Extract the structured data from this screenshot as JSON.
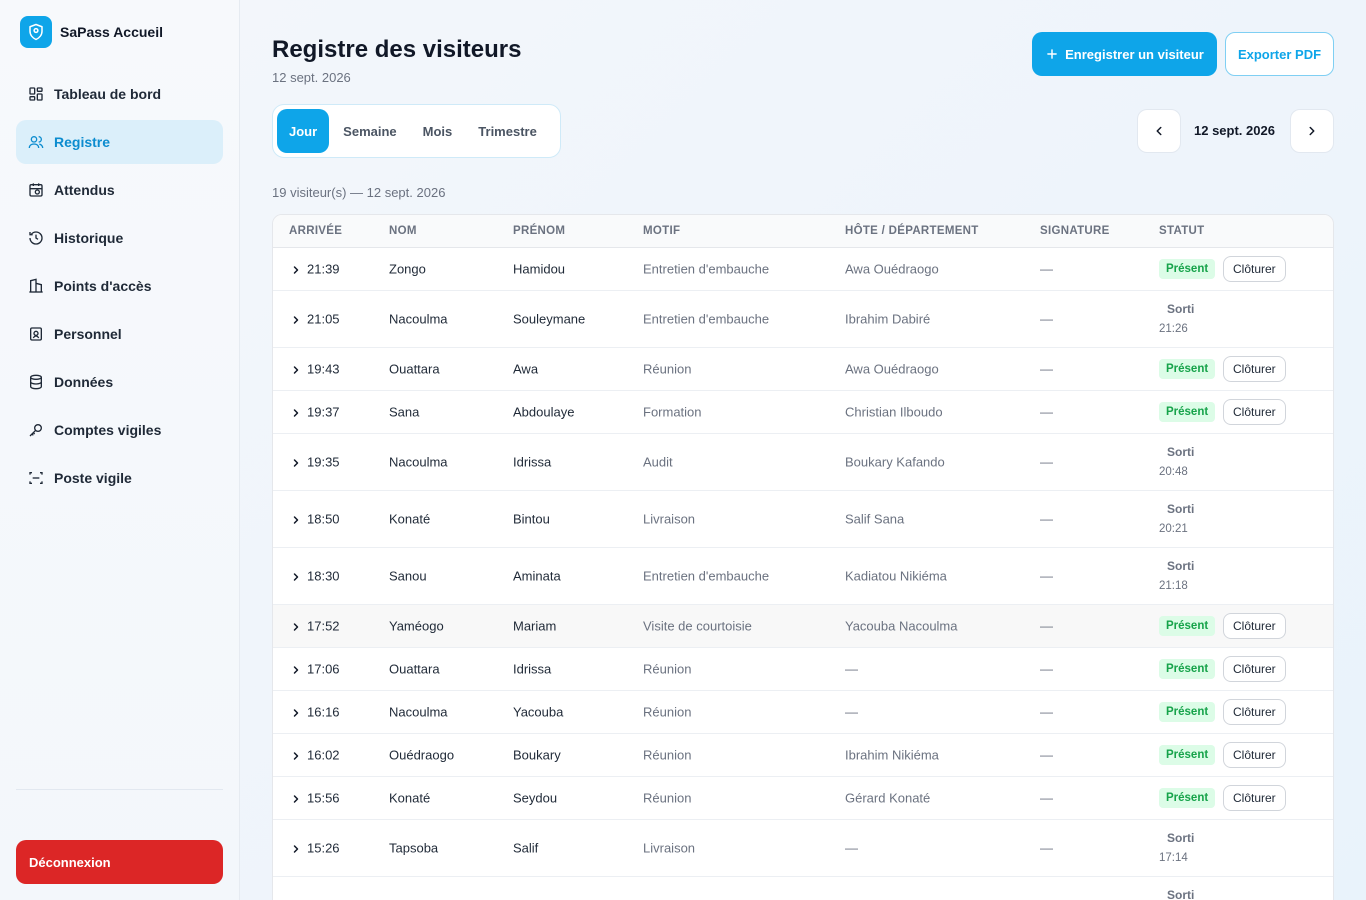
{
  "brand": {
    "name": "SaPass Accueil"
  },
  "sidebar": {
    "items": [
      {
        "label": "Tableau de bord",
        "icon": "dashboard-icon"
      },
      {
        "label": "Registre",
        "icon": "users-icon",
        "active": true
      },
      {
        "label": "Attendus",
        "icon": "calendar-clock-icon"
      },
      {
        "label": "Historique",
        "icon": "history-icon"
      },
      {
        "label": "Points d'accès",
        "icon": "building-icon"
      },
      {
        "label": "Personnel",
        "icon": "id-badge-icon"
      },
      {
        "label": "Données",
        "icon": "database-icon"
      },
      {
        "label": "Comptes vigiles",
        "icon": "key-icon"
      },
      {
        "label": "Poste vigile",
        "icon": "scan-icon"
      }
    ],
    "logout_label": "Déconnexion"
  },
  "header": {
    "title": "Registre des visiteurs",
    "date": "12 sept. 2026",
    "register_button": "Enregistrer un visiteur",
    "export_button": "Exporter PDF"
  },
  "period_tabs": [
    "Jour",
    "Semaine",
    "Mois",
    "Trimestre"
  ],
  "date_nav": {
    "label": "12 sept. 2026"
  },
  "count_label": "19 visiteur(s) — 12 sept. 2026",
  "table": {
    "columns": [
      "ARRIVÉE",
      "NOM",
      "PRÉNOM",
      "MOTIF",
      "HÔTE / DÉPARTEMENT",
      "SIGNATURE",
      "STATUT"
    ],
    "status_present": "Présent",
    "close_label": "Clôturer",
    "exited_label": "Sorti",
    "rows": [
      {
        "arrival": "21:39",
        "nom": "Zongo",
        "prenom": "Hamidou",
        "motif": "Entretien d'embauche",
        "hote": "Awa Ouédraogo",
        "signature": "—",
        "status": "present"
      },
      {
        "arrival": "21:05",
        "nom": "Nacoulma",
        "prenom": "Souleymane",
        "motif": "Entretien d'embauche",
        "hote": "Ibrahim Dabiré",
        "signature": "—",
        "status": "sorti",
        "exit_time": "21:26"
      },
      {
        "arrival": "19:43",
        "nom": "Ouattara",
        "prenom": "Awa",
        "motif": "Réunion",
        "hote": "Awa Ouédraogo",
        "signature": "—",
        "status": "present"
      },
      {
        "arrival": "19:37",
        "nom": "Sana",
        "prenom": "Abdoulaye",
        "motif": "Formation",
        "hote": "Christian Ilboudo",
        "signature": "—",
        "status": "present"
      },
      {
        "arrival": "19:35",
        "nom": "Nacoulma",
        "prenom": "Idrissa",
        "motif": "Audit",
        "hote": "Boukary Kafando",
        "signature": "—",
        "status": "sorti",
        "exit_time": "20:48"
      },
      {
        "arrival": "18:50",
        "nom": "Konaté",
        "prenom": "Bintou",
        "motif": "Livraison",
        "hote": "Salif Sana",
        "signature": "—",
        "status": "sorti",
        "exit_time": "20:21"
      },
      {
        "arrival": "18:30",
        "nom": "Sanou",
        "prenom": "Aminata",
        "motif": "Entretien d'embauche",
        "hote": "Kadiatou Nikiéma",
        "signature": "—",
        "status": "sorti",
        "exit_time": "21:18"
      },
      {
        "arrival": "17:52",
        "nom": "Yaméogo",
        "prenom": "Mariam",
        "motif": "Visite de courtoisie",
        "hote": "Yacouba Nacoulma",
        "signature": "—",
        "status": "present",
        "highlight": true
      },
      {
        "arrival": "17:06",
        "nom": "Ouattara",
        "prenom": "Idrissa",
        "motif": "Réunion",
        "hote": "—",
        "signature": "—",
        "status": "present"
      },
      {
        "arrival": "16:16",
        "nom": "Nacoulma",
        "prenom": "Yacouba",
        "motif": "Réunion",
        "hote": "—",
        "signature": "—",
        "status": "present"
      },
      {
        "arrival": "16:02",
        "nom": "Ouédraogo",
        "prenom": "Boukary",
        "motif": "Réunion",
        "hote": "Ibrahim Nikiéma",
        "signature": "—",
        "status": "present"
      },
      {
        "arrival": "15:56",
        "nom": "Konaté",
        "prenom": "Seydou",
        "motif": "Réunion",
        "hote": "Gérard Konaté",
        "signature": "—",
        "status": "present"
      },
      {
        "arrival": "15:26",
        "nom": "Tapsoba",
        "prenom": "Salif",
        "motif": "Livraison",
        "hote": "—",
        "signature": "—",
        "status": "sorti",
        "exit_time": "17:14"
      },
      {
        "arrival": "",
        "nom": "",
        "prenom": "",
        "motif": "",
        "hote": "",
        "signature": "",
        "status": "sorti",
        "exit_time": ""
      }
    ]
  },
  "colors": {
    "accent": "#0ea5e9",
    "danger": "#dc2626",
    "success": "#16a34a"
  }
}
